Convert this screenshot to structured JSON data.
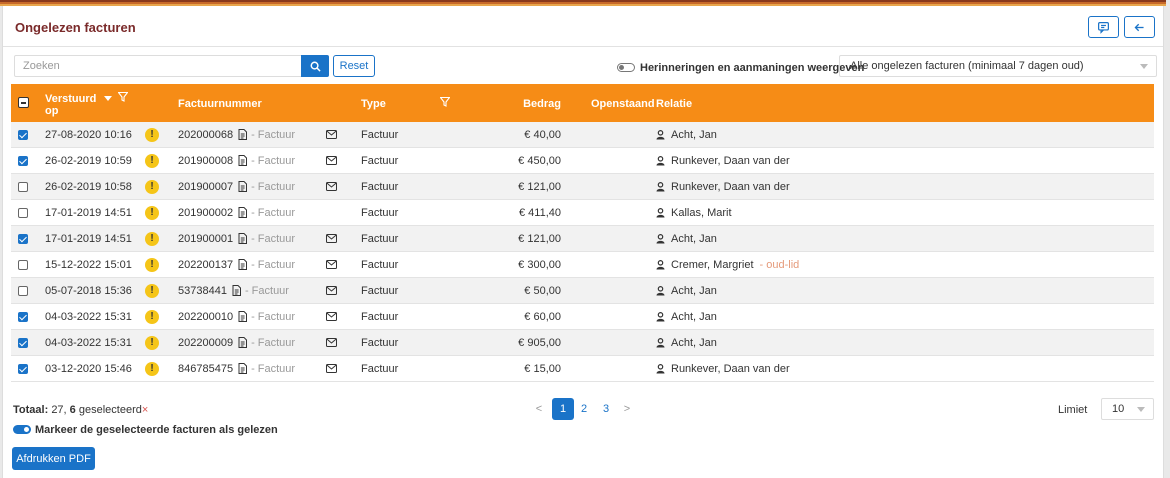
{
  "page": {
    "title": "Ongelezen facturen"
  },
  "search": {
    "placeholder": "Zoeken",
    "reset_label": "Reset"
  },
  "filters": {
    "toggle_label": "Herinneringen en aanmaningen weergeven",
    "toggle_on": false,
    "select_value": "Alle ongelezen facturen (minimaal 7 dagen oud)"
  },
  "columns": {
    "sent": "Verstuurd op",
    "number": "Factuurnummer",
    "type": "Type",
    "amount": "Bedrag",
    "outstanding": "Openstaand",
    "relation": "Relatie"
  },
  "rows": [
    {
      "checked": true,
      "sent": "27-08-2020 10:16",
      "number": "202000068",
      "doctype": "- Factuur",
      "mail": true,
      "type": "Factuur",
      "amount": "€ 40,00",
      "relation": "Acht, Jan",
      "extra": ""
    },
    {
      "checked": true,
      "sent": "26-02-2019 10:59",
      "number": "201900008",
      "doctype": "- Factuur",
      "mail": true,
      "type": "Factuur",
      "amount": "€ 450,00",
      "relation": "Runkever, Daan van der",
      "extra": ""
    },
    {
      "checked": false,
      "sent": "26-02-2019 10:58",
      "number": "201900007",
      "doctype": "- Factuur",
      "mail": true,
      "type": "Factuur",
      "amount": "€ 121,00",
      "relation": "Runkever, Daan van der",
      "extra": ""
    },
    {
      "checked": false,
      "sent": "17-01-2019 14:51",
      "number": "201900002",
      "doctype": "- Factuur",
      "mail": false,
      "type": "Factuur",
      "amount": "€ 411,40",
      "relation": "Kallas, Marit",
      "extra": ""
    },
    {
      "checked": true,
      "sent": "17-01-2019 14:51",
      "number": "201900001",
      "doctype": "- Factuur",
      "mail": true,
      "type": "Factuur",
      "amount": "€ 121,00",
      "relation": "Acht, Jan",
      "extra": ""
    },
    {
      "checked": false,
      "sent": "15-12-2022 15:01",
      "number": "202200137",
      "doctype": "- Factuur",
      "mail": true,
      "type": "Factuur",
      "amount": "€ 300,00",
      "relation": "Cremer, Margriet",
      "extra": "- oud-lid"
    },
    {
      "checked": false,
      "sent": "05-07-2018 15:36",
      "number": "53738441",
      "doctype": "- Factuur",
      "mail": true,
      "type": "Factuur",
      "amount": "€ 50,00",
      "relation": "Acht, Jan",
      "extra": ""
    },
    {
      "checked": true,
      "sent": "04-03-2022 15:31",
      "number": "202200010",
      "doctype": "- Factuur",
      "mail": true,
      "type": "Factuur",
      "amount": "€ 60,00",
      "relation": "Acht, Jan",
      "extra": ""
    },
    {
      "checked": true,
      "sent": "04-03-2022 15:31",
      "number": "202200009",
      "doctype": "- Factuur",
      "mail": true,
      "type": "Factuur",
      "amount": "€ 905,00",
      "relation": "Acht, Jan",
      "extra": ""
    },
    {
      "checked": true,
      "sent": "03-12-2020 15:46",
      "number": "846785475",
      "doctype": "- Factuur",
      "mail": true,
      "type": "Factuur",
      "amount": "€ 15,00",
      "relation": "Runkever, Daan van der",
      "extra": ""
    }
  ],
  "footer": {
    "total_label": "Totaal:",
    "total_count": "27,",
    "selected_count": "6",
    "selected_label": "geselecteerd",
    "selected_clear": "×",
    "pages": [
      "1",
      "2",
      "3"
    ],
    "current_page": "1",
    "prev": "<",
    "next": ">",
    "limit_label": "Limiet",
    "limit_value": "10",
    "mark_read_label": "Markeer de geselecteerde facturen als gelezen",
    "mark_read_on": true,
    "pdf_button": "Afdrukken PDF"
  },
  "colors": {
    "accent": "#1a73c8",
    "header": "#f68c16",
    "title": "#7a2a2a",
    "warning": "#f5c518"
  },
  "icons": {
    "header_buttons": [
      "comment-icon",
      "arrow-left-icon"
    ],
    "search": "search-icon",
    "status": "warning-icon",
    "document": "document-icon",
    "mail": "envelope-icon",
    "relation": "user-icon",
    "filter": "filter-icon",
    "sort": "sort-icon"
  }
}
